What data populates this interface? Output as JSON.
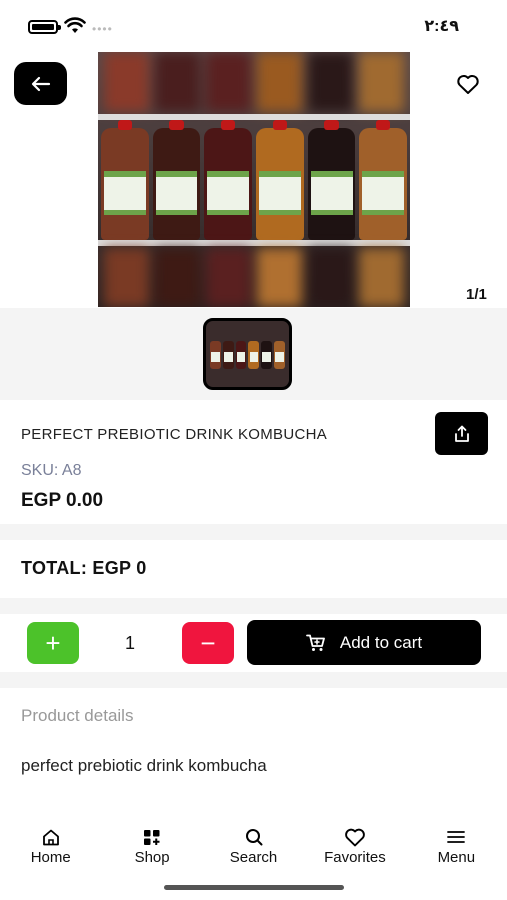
{
  "status_bar": {
    "time": "٢:٤٩"
  },
  "product": {
    "name": "PERFECT PREBIOTIC DRINK KOMBUCHA",
    "sku": "SKU: A8",
    "price": "EGP 0.00",
    "image_counter": "1/1"
  },
  "total": "TOTAL: EGP 0",
  "quantity": {
    "plus_label": "+",
    "value": "1",
    "minus_label": "−"
  },
  "cart": {
    "add_label": "Add to cart"
  },
  "details": {
    "title": "Product details",
    "text": "perfect prebiotic drink kombucha"
  },
  "nav": {
    "items": [
      {
        "label": "Home",
        "icon": "home-icon"
      },
      {
        "label": "Shop",
        "icon": "shop-icon"
      },
      {
        "label": "Search",
        "icon": "search-icon"
      },
      {
        "label": "Favorites",
        "icon": "heart-icon"
      },
      {
        "label": "Menu",
        "icon": "menu-icon"
      }
    ]
  },
  "colors": {
    "plus_button": "#4cc22a",
    "minus_button": "#f0153e",
    "primary_dark": "#000000",
    "sku_text": "#7a8099"
  }
}
